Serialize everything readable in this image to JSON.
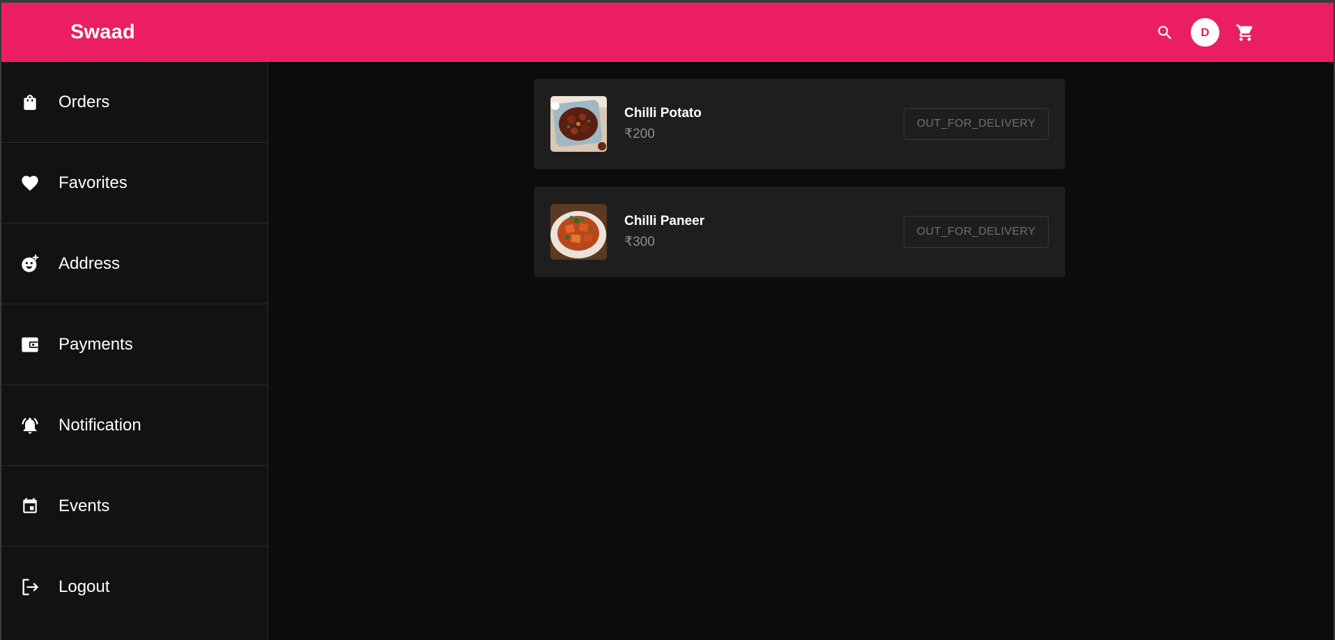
{
  "app": {
    "title": "Swaad",
    "avatar_initial": "D"
  },
  "header": {
    "icons": [
      "search-icon",
      "cart-icon"
    ]
  },
  "sidebar": {
    "items": [
      {
        "label": "Orders",
        "icon": "shopping-bag-icon"
      },
      {
        "label": "Favorites",
        "icon": "heart-icon"
      },
      {
        "label": "Address",
        "icon": "emoji-add-icon"
      },
      {
        "label": "Payments",
        "icon": "wallet-icon"
      },
      {
        "label": "Notification",
        "icon": "notification-bell-icon"
      },
      {
        "label": "Events",
        "icon": "calendar-icon"
      },
      {
        "label": "Logout",
        "icon": "logout-icon"
      }
    ]
  },
  "orders": [
    {
      "name": "Chilli Potato",
      "price": "₹200",
      "status": "OUT_FOR_DELIVERY"
    },
    {
      "name": "Chilli Paneer",
      "price": "₹300",
      "status": "OUT_FOR_DELIVERY"
    }
  ],
  "colors": {
    "accent": "#eb1d63",
    "background": "#0c0c0c",
    "sidebar": "#121212",
    "card": "#1e1e1e"
  }
}
